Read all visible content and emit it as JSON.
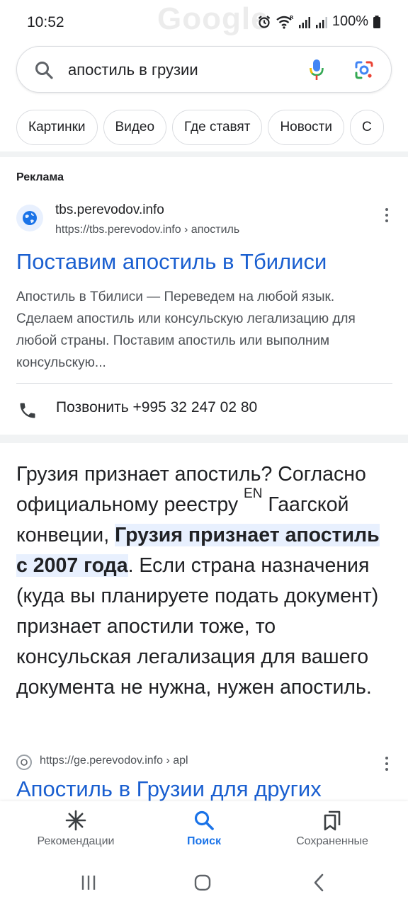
{
  "status_bar": {
    "time": "10:52",
    "watermark": "Google",
    "battery": "100%",
    "icons": [
      "alarm-icon",
      "wifi-icon",
      "signal-icon",
      "signal-icon",
      "battery-icon"
    ]
  },
  "search": {
    "query": "апостиль в грузии",
    "icons": [
      "search-icon",
      "mic-icon",
      "lens-icon"
    ]
  },
  "chips": [
    "Картинки",
    "Видео",
    "Где ставят",
    "Новости",
    "С"
  ],
  "ad": {
    "label": "Реклама",
    "site_name": "tbs.perevodov.info",
    "site_url": "https://tbs.perevodov.info › апостиль",
    "title": "Поставим апостиль в Тбилиси",
    "description": "Апостиль в Тбилиси — Переведем на любой язык. Сделаем апостиль или консульскую легализацию для любой страны. Поставим апостиль или выполним консульскую...",
    "call_label": "Позвонить +995 32 247 02 80"
  },
  "snippet": {
    "part1": "Грузия признает апостиль? Согласно официальному реестру",
    "sup": "EN",
    "part2": "Гаагской конвеции,",
    "highlight": "Грузия признает апостиль с 2007 года",
    "part3": ". Если страна назначения (куда вы планируете подать документ) признает апостили тоже, то консульская легализация для вашего документа не нужна, нужен апостиль."
  },
  "result": {
    "url": "https://ge.perevodov.info › apl",
    "title": "Апостиль в Грузии для других"
  },
  "bottom_nav": [
    {
      "label": "Рекомендации",
      "icon": "asterisk-icon",
      "active": false
    },
    {
      "label": "Поиск",
      "icon": "search-icon",
      "active": true
    },
    {
      "label": "Сохраненные",
      "icon": "bookmark-icon",
      "active": false
    }
  ],
  "colors": {
    "link": "#1a5fd0",
    "accent": "#1a73e8",
    "highlight": "#e8f0fe",
    "secondary_text": "#4d5156"
  }
}
